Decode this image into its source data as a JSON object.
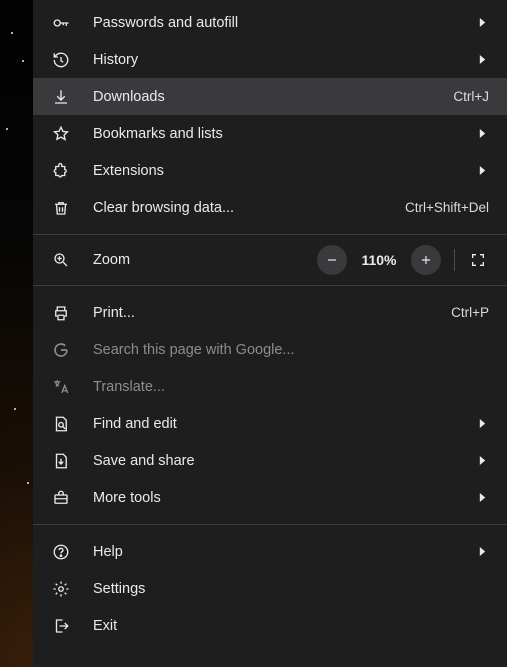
{
  "menu": {
    "group1": [
      {
        "label": "Passwords and autofill",
        "hasSub": true
      },
      {
        "label": "History",
        "hasSub": true
      },
      {
        "label": "Downloads",
        "accel": "Ctrl+J",
        "hover": true
      },
      {
        "label": "Bookmarks and lists",
        "hasSub": true
      },
      {
        "label": "Extensions",
        "hasSub": true
      },
      {
        "label": "Clear browsing data...",
        "accel": "Ctrl+Shift+Del"
      }
    ],
    "zoom": {
      "label": "Zoom",
      "value": "110%"
    },
    "group2": [
      {
        "label": "Print...",
        "accel": "Ctrl+P"
      },
      {
        "label": "Search this page with Google...",
        "disabled": true
      },
      {
        "label": "Translate...",
        "disabled": true
      },
      {
        "label": "Find and edit",
        "hasSub": true
      },
      {
        "label": "Save and share",
        "hasSub": true
      },
      {
        "label": "More tools",
        "hasSub": true
      }
    ],
    "group3": [
      {
        "label": "Help",
        "hasSub": true
      },
      {
        "label": "Settings"
      },
      {
        "label": "Exit"
      }
    ]
  }
}
